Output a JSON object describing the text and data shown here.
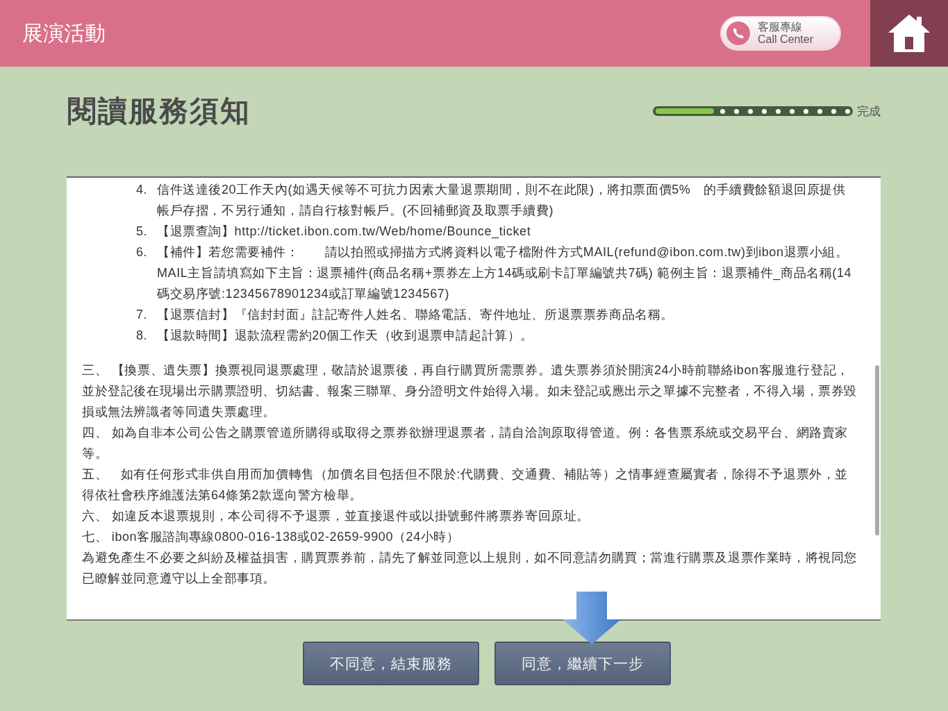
{
  "header": {
    "title": "展演活動",
    "call_center": {
      "line1": "客服專線",
      "line2": "Call Center"
    }
  },
  "page_title": "閱讀服務須知",
  "progress": {
    "level": 0.3,
    "end_label": "完成"
  },
  "notice": {
    "items": [
      {
        "number": "4.",
        "text": "信件送達後20工作天內(如遇天候等不可抗力因素大量退票期間，則不在此限)，將扣票面價5%　的手續費餘額退回原提供帳戶存摺，不另行通知，請自行核對帳戶。(不回補郵資及取票手續費)"
      },
      {
        "number": "5.",
        "text": "【退票查詢】http://ticket.ibon.com.tw/Web/home/Bounce_ticket"
      },
      {
        "number": "6.",
        "text": "【補件】若您需要補件：　　請以拍照或掃描方式將資料以電子檔附件方式MAIL(refund@ibon.com.tw)到ibon退票小組。 MAIL主旨請填寫如下主旨：退票補件(商品名稱+票券左上方14碼或刷卡訂單編號共7碼) 範例主旨：退票補件_商品名稱(14碼交易序號:12345678901234或訂單編號1234567)"
      },
      {
        "number": "7.",
        "text": "【退票信封】『信封封面』註記寄件人姓名、聯絡電話、寄件地址、所退票票券商品名稱。"
      },
      {
        "number": "8.",
        "text": "【退款時間】退款流程需約20個工作天（收到退票申請起計算）。"
      }
    ],
    "paragraphs": [
      "三、 【換票、遺失票】換票視同退票處理，敬請於退票後，再自行購買所需票券。遺失票券須於開演24小時前聯絡ibon客服進行登記，並於登記後在現場出示購票證明、切結書、報案三聯單、身分證明文件始得入場。如未登記或應出示之單據不完整者，不得入場，票券毀損或無法辨識者等同遺失票處理。",
      "四、 如為自非本公司公告之購票管道所購得或取得之票券欲辦理退票者，請自洽詢原取得管道。例：各售票系統或交易平台、網路賣家等。",
      "五、　如有任何形式非供自用而加價轉售（加價名目包括但不限於:代購費、交通費、補貼等）之情事經查屬實者，除得不予退票外，並得依社會秩序維護法第64條第2款逕向警方檢舉。",
      "六、 如違反本退票規則，本公司得不予退票，並直接退件或以掛號郵件將票券寄回原址。",
      "七、 ibon客服諮詢專線0800-016-138或02-2659-9900（24小時）",
      "為避免產生不必要之糾紛及權益損害，購買票券前，請先了解並同意以上規則，如不同意請勿購買；當進行購票及退票作業時，將視同您已瞭解並同意遵守以上全部事項。"
    ]
  },
  "buttons": [
    "不同意，結束服務",
    "同意，繼續下一步"
  ]
}
